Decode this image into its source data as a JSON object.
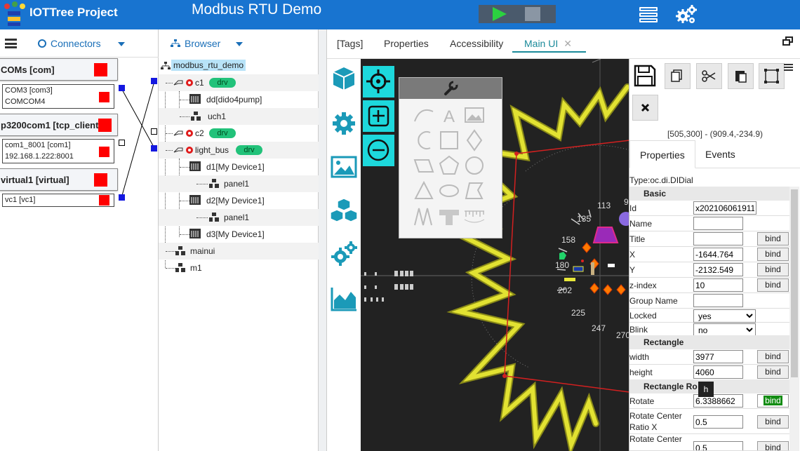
{
  "app": {
    "name": "IOTTree Project",
    "project_title": "Modbus RTU Demo"
  },
  "connectors": {
    "tab_label": "Connectors",
    "groups": [
      {
        "title": "COMs [com]",
        "channels": [
          {
            "line1": "COM3 [com3]",
            "line2": "COMCOM4"
          }
        ]
      },
      {
        "title": "p3200com1 [tcp_client]",
        "channels": [
          {
            "line1": "com1_8001 [com1]",
            "line2": "192.168.1.222:8001"
          }
        ]
      },
      {
        "title": "virtual1 [virtual]",
        "channels": [
          {
            "line1": "vc1 [vc1]",
            "line2": ""
          }
        ]
      }
    ]
  },
  "browser": {
    "tab_label": "Browser",
    "root": "modbus_rtu_demo",
    "nodes": [
      {
        "label": "c1",
        "badge": "drv"
      },
      {
        "label": "dd[dido4pump]"
      },
      {
        "label": "uch1"
      },
      {
        "label": "c2",
        "badge": "drv"
      },
      {
        "label": "light_bus",
        "badge": "drv"
      },
      {
        "label": "d1[My Device1]"
      },
      {
        "label": "panel1"
      },
      {
        "label": "d2[My Device1]"
      },
      {
        "label": "panel1"
      },
      {
        "label": "d3[My Device1]"
      },
      {
        "label": "mainui"
      },
      {
        "label": "m1"
      }
    ]
  },
  "tabs": {
    "items": [
      "[Tags]",
      "Properties",
      "Accessibility",
      "Main UI"
    ],
    "active": "Main UI",
    "close_glyph": "✕"
  },
  "canvas": {
    "dial_ticks": [
      "113",
      "135",
      "158",
      "180",
      "202",
      "225",
      "247",
      "270",
      "9"
    ]
  },
  "properties": {
    "coord_readout": "[505,300] - (909.4,-234.9)",
    "tabs": [
      "Properties",
      "Events"
    ],
    "type_line": "Type:oc.di.DIDial",
    "bind_label": "bind",
    "sections": {
      "basic": "Basic",
      "rectangle": "Rectangle",
      "rect_rotation": "Rectangle Ro"
    },
    "rows": {
      "id": {
        "label": "Id",
        "value": "x202106061911"
      },
      "name": {
        "label": "Name",
        "value": ""
      },
      "title": {
        "label": "Title",
        "value": ""
      },
      "x": {
        "label": "X",
        "value": "-1644.764"
      },
      "y": {
        "label": "Y",
        "value": "-2132.549"
      },
      "z_index": {
        "label": "z-index",
        "value": "10"
      },
      "group_name": {
        "label": "Group Name",
        "value": ""
      },
      "locked": {
        "label": "Locked",
        "value": "yes"
      },
      "blink": {
        "label": "Blink",
        "value": "no"
      },
      "width": {
        "label": "width",
        "value": "3977"
      },
      "height": {
        "label": "height",
        "value": "4060"
      },
      "rotate": {
        "label": "Rotate",
        "value": "6.3388662"
      },
      "rot_center_x": {
        "label1": "Rotate Center",
        "label2": "Ratio X",
        "value": "0.5"
      },
      "rot_center_y": {
        "label1": "Rotate Center",
        "value": "0.5"
      }
    },
    "tooltip": "h"
  },
  "colors": {
    "topbar": "#1874d0",
    "accent": "#1dd8dc",
    "status_off": "#ff0000",
    "drv_badge": "#22c27a",
    "canvas_bg": "#222222",
    "gear_yellow": "#d9d21a"
  }
}
